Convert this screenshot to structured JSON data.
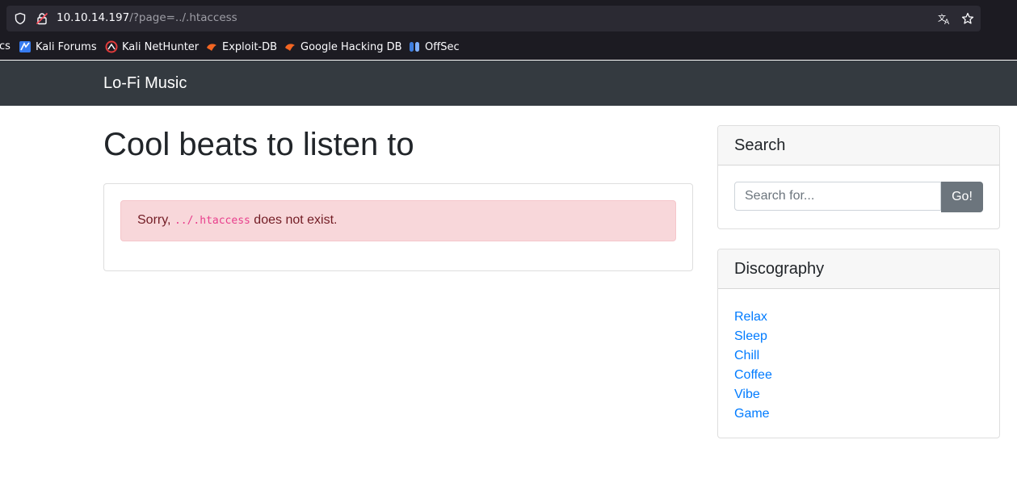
{
  "browser": {
    "url_host": "10.10.14.197",
    "url_path": "/?page=../.htaccess",
    "bookmarks": [
      {
        "label": "cs",
        "icon": "truncated"
      },
      {
        "label": "Kali Forums",
        "icon": "kali-forums-icon"
      },
      {
        "label": "Kali NetHunter",
        "icon": "kali-nethunter-icon"
      },
      {
        "label": "Exploit-DB",
        "icon": "exploit-db-icon"
      },
      {
        "label": "Google Hacking DB",
        "icon": "ghdb-icon"
      },
      {
        "label": "OffSec",
        "icon": "offsec-icon"
      }
    ]
  },
  "navbar": {
    "brand": "Lo-Fi Music"
  },
  "main": {
    "title": "Cool beats to listen to",
    "alert": {
      "prefix": "Sorry, ",
      "code": "../.htaccess",
      "suffix": " does not exist."
    }
  },
  "search": {
    "header": "Search",
    "placeholder": "Search for...",
    "button": "Go!"
  },
  "discography": {
    "header": "Discography",
    "items": [
      "Relax",
      "Sleep",
      "Chill",
      "Coffee",
      "Vibe",
      "Game"
    ]
  },
  "colors": {
    "navbar_bg": "#343a40",
    "alert_bg": "#f8d7da",
    "alert_text": "#721c24",
    "code_pink": "#e83e8c",
    "link_blue": "#007bff",
    "button_gray": "#6c757d"
  }
}
